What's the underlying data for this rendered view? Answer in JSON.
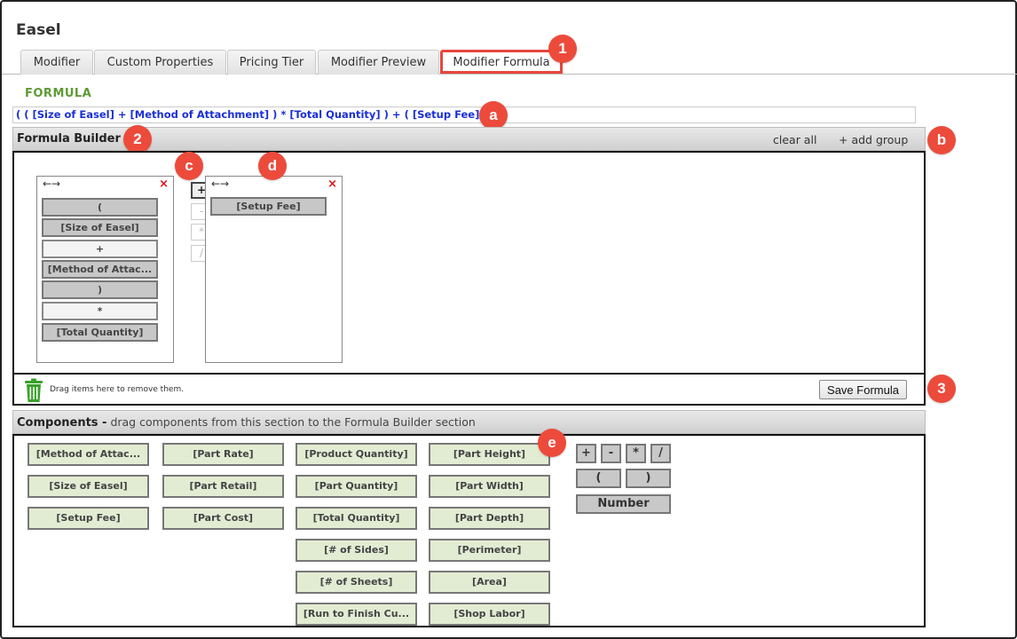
{
  "page": {
    "title": "Easel"
  },
  "tabs": [
    {
      "label": "Modifier"
    },
    {
      "label": "Custom Properties"
    },
    {
      "label": "Pricing Tier"
    },
    {
      "label": "Modifier Preview"
    },
    {
      "label": "Modifier Formula",
      "active": true
    }
  ],
  "callouts": {
    "one": "1",
    "two": "2",
    "three": "3",
    "a": "a",
    "b": "b",
    "c": "c",
    "d": "d",
    "e": "e"
  },
  "formula": {
    "label": "FORMULA",
    "expression": "( ( [Size of Easel] + [Method of Attachment] ) * [Total Quantity] ) + ( [Setup Fee] )"
  },
  "builder": {
    "title": "Formula Builder",
    "clear_all": "clear all",
    "add_group": "+ add group",
    "group_arrows": "←→",
    "close_glyph": "×",
    "group1_tokens": [
      "(",
      "[Size of Easel]",
      "+",
      "[Method of Attac...",
      ")",
      "*",
      "[Total Quantity]"
    ],
    "operators": [
      "+",
      "-",
      "*",
      "/"
    ],
    "group2_tokens": [
      "[Setup Fee]"
    ],
    "trash_text": "Drag items here to remove them.",
    "save_label": "Save Formula"
  },
  "components": {
    "title": "Components -",
    "subtitle": " drag components from this section to the Formula Builder section",
    "col1": [
      "[Method of Attac...",
      "[Size of Easel]",
      "[Setup Fee]"
    ],
    "col2": [
      "[Part Rate]",
      "[Part Retail]",
      "[Part Cost]"
    ],
    "col3": [
      "[Product Quantity]",
      "[Part Quantity]",
      "[Total Quantity]",
      "[# of Sides]",
      "[# of Sheets]",
      "[Run to Finish Cu..."
    ],
    "col4": [
      "[Part Height]",
      "[Part Width]",
      "[Part Depth]",
      "[Perimeter]",
      "[Area]",
      "[Shop Labor]"
    ],
    "operators": [
      "+",
      "-",
      "*",
      "/"
    ],
    "parens": [
      "(",
      ")"
    ],
    "number_label": "Number"
  },
  "colors": {
    "callout": "#ec4b3c",
    "formula_text": "#1a2fd8",
    "section_label": "#5f9a35",
    "component_fill": "#e2ecd3",
    "close_x": "#e01010",
    "trash": "#3aa12a"
  }
}
